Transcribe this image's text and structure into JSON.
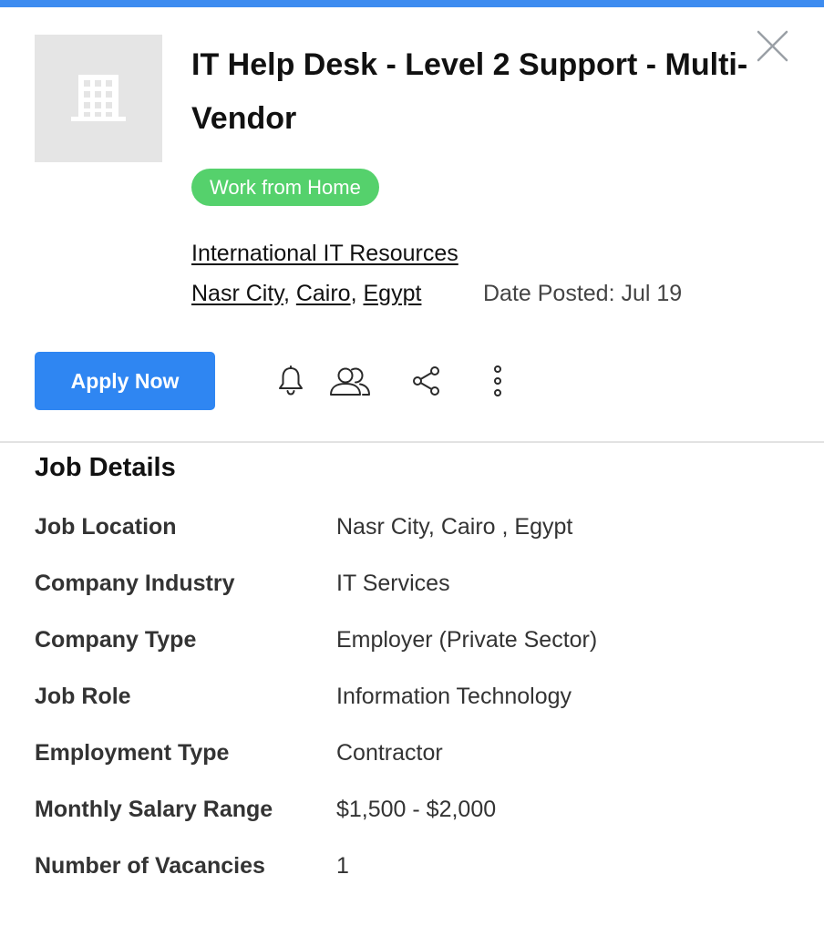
{
  "colors": {
    "accent_bar": "#3d8cf0",
    "apply_button": "#2f86f2",
    "badge_bg": "#55d16c",
    "icon_stroke": "#2a2a2a",
    "close_icon": "#9aa0a6"
  },
  "header": {
    "title": "IT Help Desk - Level 2 Support - Multi-Vendor",
    "badge": "Work from Home",
    "company": "International IT Resources",
    "location": {
      "city": "Nasr City",
      "region": "Cairo",
      "country": "Egypt",
      "separator": ", "
    },
    "date_posted": "Date Posted: Jul 19",
    "logo_icon": "building-icon",
    "close_icon": "close-icon"
  },
  "actions": {
    "apply_label": "Apply Now",
    "icons": [
      "bell-icon",
      "users-icon",
      "share-icon",
      "more-vertical-icon"
    ]
  },
  "job_details": {
    "title": "Job Details",
    "rows": [
      {
        "label": "Job Location",
        "value": "Nasr City, Cairo , Egypt"
      },
      {
        "label": "Company Industry",
        "value": "IT Services"
      },
      {
        "label": "Company Type",
        "value": "Employer (Private Sector)"
      },
      {
        "label": "Job Role",
        "value": "Information Technology"
      },
      {
        "label": "Employment Type",
        "value": "Contractor"
      },
      {
        "label": "Monthly Salary Range",
        "value": "$1,500 - $2,000"
      },
      {
        "label": "Number of Vacancies",
        "value": "1"
      }
    ]
  }
}
